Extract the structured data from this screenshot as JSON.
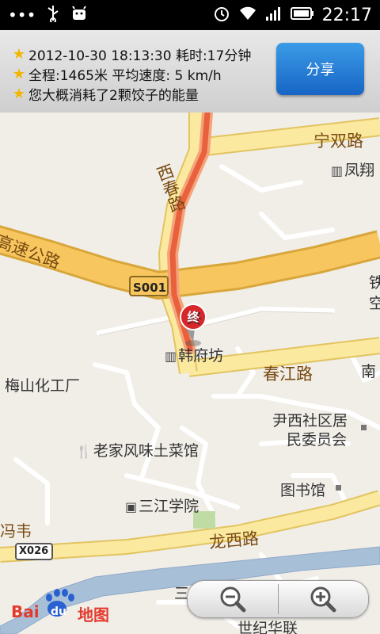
{
  "status_bar": {
    "time": "22:17",
    "left_icons": [
      "more-dots-icon",
      "usb-icon",
      "android-debug-icon"
    ],
    "right_icons": [
      "alarm-icon",
      "wifi-icon",
      "signal-icon",
      "battery-icon"
    ]
  },
  "trip_info": {
    "line1": "2012-10-30 18:13:30 耗时:17分钟",
    "line2": "全程:1465米 平均速度: 5 km/h",
    "line3": "您大概消耗了2颗饺子的能量",
    "share_label": "分享"
  },
  "map": {
    "roads": {
      "ningshuang": "宁双路",
      "xichun": "西春路",
      "gaosu": "高速公路",
      "chunjiang": "春江路",
      "longxi": "龙西路",
      "s001": "S001",
      "x026": "X026"
    },
    "pois": {
      "fengxiang": "凤翔",
      "hanfufang": "韩府坊",
      "meishan": "梅山化工厂",
      "yinxi": "尹西社区居",
      "yinxi2": "民委员会",
      "laojia": "老家风味土菜馆",
      "tushuguan": "图书馆",
      "sanjiang": "三江学院",
      "fengwei": "冯韦",
      "shijihualian": "世纪华联",
      "edge_tie": "铁",
      "edge_kong": "空",
      "edge_nan": "南",
      "edge_san": "三"
    },
    "end_marker": "终",
    "logo_text": "Bai",
    "logo_du": "du",
    "logo_map": "地图"
  }
}
